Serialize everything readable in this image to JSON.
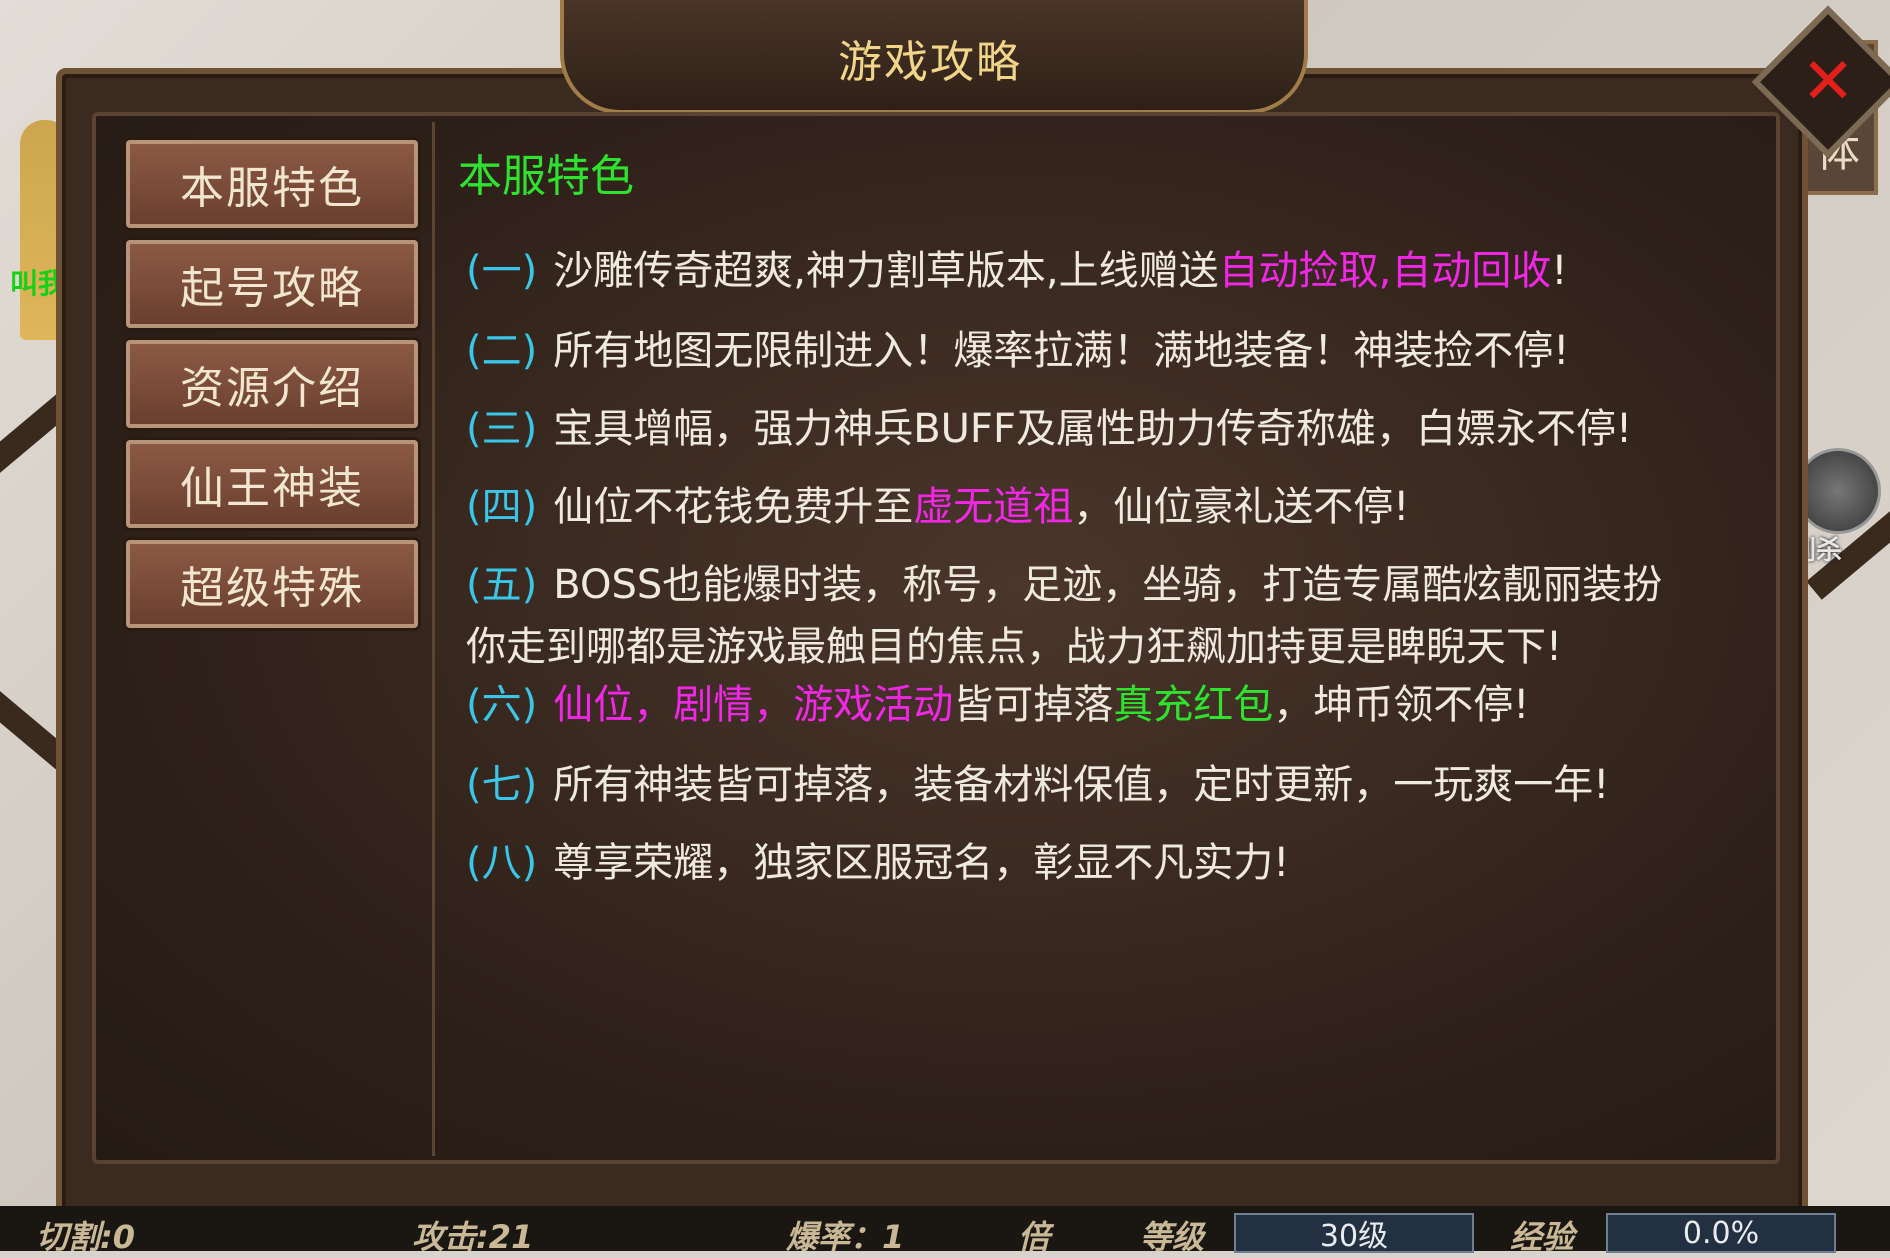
{
  "window": {
    "title": "游戏攻略",
    "close_icon": "close-icon"
  },
  "background": {
    "left_tag": "叫我",
    "right_tab": "体",
    "right_skill_label": "刺杀"
  },
  "sidebar": {
    "items": [
      {
        "label": "本服特色"
      },
      {
        "label": "起号攻略"
      },
      {
        "label": "资源介绍"
      },
      {
        "label": "仙王神装"
      },
      {
        "label": "超级特殊"
      }
    ]
  },
  "content": {
    "section_title": "本服特色",
    "items": [
      {
        "num": "(一)",
        "parts": [
          "沙雕传奇超爽,神力割草版本,上线赠送",
          "自动捡取,自动回收",
          "!"
        ]
      },
      {
        "num": "(二)",
        "text": "所有地图无限制进入！爆率拉满！满地装备！神装捡不停!"
      },
      {
        "num": "(三)",
        "text": "宝具增幅，强力神兵BUFF及属性助力传奇称雄，白嫖永不停!"
      },
      {
        "num": "(四)",
        "parts": [
          "仙位不花钱免费升至",
          "虚无道祖",
          "，仙位豪礼送不停!"
        ]
      },
      {
        "num": "(五)",
        "text": "BOSS也能爆时装，称号，足迹，坐骑，打造专属酷炫靓丽装扮",
        "line2": "你走到哪都是游戏最触目的焦点，战力狂飙加持更是睥睨天下!"
      },
      {
        "num": "(六)",
        "parts": [
          "仙位，剧情，游戏活动",
          "皆可掉落",
          "真充红包",
          "，坤币领不停!"
        ]
      },
      {
        "num": "(七)",
        "text": "所有神装皆可掉落，装备材料保值，定时更新，一玩爽一年!"
      },
      {
        "num": "(八)",
        "text": "尊享荣耀，独家区服冠名，彰显不凡实力!"
      }
    ]
  },
  "status_bar": {
    "cut_label": "切割:0",
    "attack_label": "攻击:21",
    "drop_rate_label": "爆率：1",
    "multiplier_label": "倍",
    "level_label": "等级",
    "level_value": "30级",
    "exp_label": "经验",
    "exp_value": "0.0%"
  }
}
